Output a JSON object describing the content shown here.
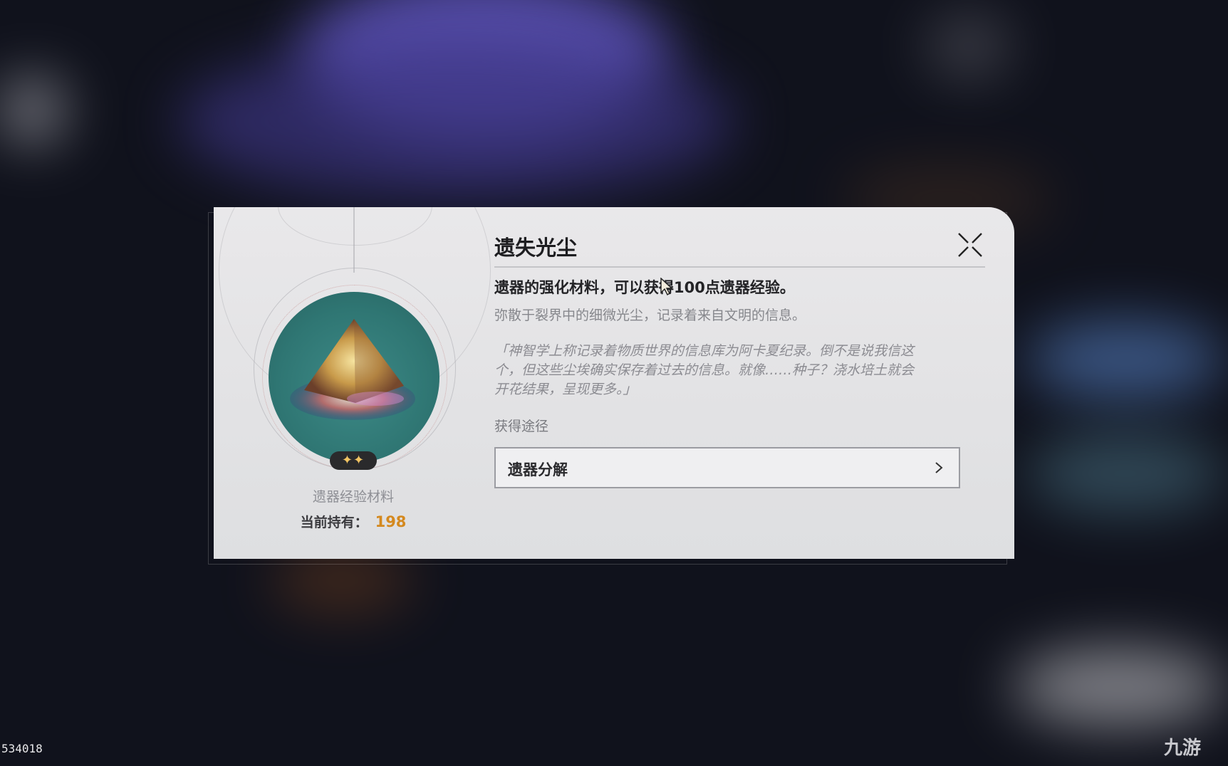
{
  "item": {
    "name": "遗失光尘",
    "rarity_stars": "✦✦",
    "type": "遗器经验材料",
    "holding_label": "当前持有：",
    "holding_count": "198"
  },
  "description": {
    "main": "遗器的强化材料，可以获得100点遗器经验。",
    "sub": "弥散于裂界中的细微光尘，记录着来自文明的信息。",
    "quote_lines": [
      "「神智学上称记录着物质世界的信息库为阿卡夏纪录。倒不是说我信这",
      "个，但这些尘埃确实保存着过去的信息。就像……种子？浇水培土就会",
      "开花结果，呈现更多。」"
    ]
  },
  "sources": {
    "label": "获得途径",
    "items": [
      {
        "label": "遗器分解"
      }
    ]
  },
  "overlay": {
    "frame_id": "534018",
    "watermark": "九游"
  },
  "colors": {
    "accent_count": "#d4891f",
    "star": "#f1c463",
    "item_bg": "#2f7673"
  }
}
